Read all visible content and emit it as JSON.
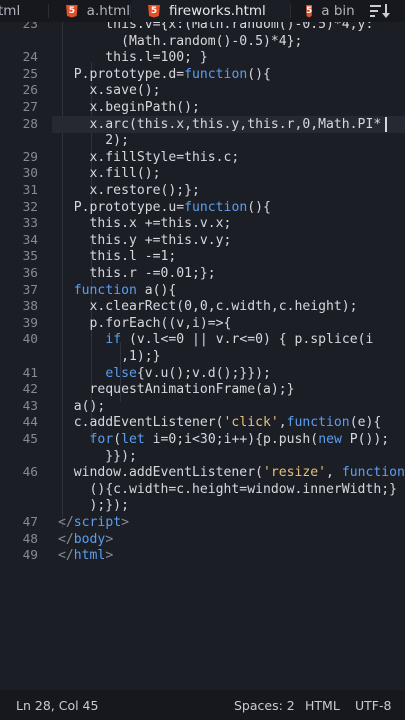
{
  "tabs": [
    {
      "label": "tml",
      "html_icon": false,
      "active": false
    },
    {
      "label": "a.html",
      "html_icon": true,
      "active": false
    },
    {
      "label": "fireworks.html",
      "html_icon": true,
      "active": true
    },
    {
      "label": "a bing",
      "html_icon": true,
      "active": false
    }
  ],
  "icons": {
    "html_file": "html5-file-icon",
    "html_glyph": "5",
    "tab_overflow": "sort-list-icon"
  },
  "editor": {
    "lines": [
      {
        "n": "23",
        "top_clip": true,
        "segs": [
          [
            "      this.v={x:(Math.random()-0.5)*4,y:",
            ""
          ]
        ]
      },
      {
        "n": "",
        "segs": [
          [
            "        (Math.random()-0.5)*4};",
            ""
          ]
        ]
      },
      {
        "n": "24",
        "segs": [
          [
            "      this.l=100; }",
            ""
          ]
        ]
      },
      {
        "n": "25",
        "segs": [
          [
            "  P.prototype.d=",
            ""
          ],
          [
            "function",
            "k"
          ],
          [
            "(){",
            ""
          ]
        ]
      },
      {
        "n": "26",
        "segs": [
          [
            "    x.save();",
            ""
          ]
        ]
      },
      {
        "n": "27",
        "segs": [
          [
            "    x.beginPath();",
            ""
          ]
        ]
      },
      {
        "n": "28",
        "current": true,
        "segs": [
          [
            "    x.arc(this.x,this.y,this.r,0,Math.PI*",
            ""
          ]
        ]
      },
      {
        "n": "",
        "segs": [
          [
            "      2);",
            ""
          ]
        ]
      },
      {
        "n": "29",
        "segs": [
          [
            "    x.fillStyle=this.c;",
            ""
          ]
        ]
      },
      {
        "n": "30",
        "segs": [
          [
            "    x.fill();",
            ""
          ]
        ]
      },
      {
        "n": "31",
        "segs": [
          [
            "    x.restore();};",
            ""
          ]
        ]
      },
      {
        "n": "32",
        "segs": [
          [
            "  P.prototype.u=",
            ""
          ],
          [
            "function",
            "k"
          ],
          [
            "(){",
            ""
          ]
        ]
      },
      {
        "n": "33",
        "segs": [
          [
            "    this.x +=this.v.x;",
            ""
          ]
        ]
      },
      {
        "n": "34",
        "segs": [
          [
            "    this.y +=this.v.y;",
            ""
          ]
        ]
      },
      {
        "n": "35",
        "segs": [
          [
            "    this.l -=1;",
            ""
          ]
        ]
      },
      {
        "n": "36",
        "segs": [
          [
            "    this.r -=0.01;};",
            ""
          ]
        ]
      },
      {
        "n": "37",
        "segs": [
          [
            "  ",
            ""
          ],
          [
            "function",
            "k"
          ],
          [
            " a(){",
            ""
          ]
        ]
      },
      {
        "n": "38",
        "segs": [
          [
            "    x.clearRect(0,0,c.width,c.height);",
            ""
          ]
        ]
      },
      {
        "n": "39",
        "segs": [
          [
            "    p.forEach((v,i)=>{",
            ""
          ]
        ]
      },
      {
        "n": "40",
        "segs": [
          [
            "      ",
            ""
          ],
          [
            "if",
            "k"
          ],
          [
            " (v.l<=0 || v.r<=0) { p.splice(i",
            ""
          ]
        ]
      },
      {
        "n": "",
        "segs": [
          [
            "        ,1);}",
            ""
          ]
        ]
      },
      {
        "n": "41",
        "segs": [
          [
            "      ",
            ""
          ],
          [
            "else",
            "k"
          ],
          [
            "{v.u();v.d();}});",
            ""
          ]
        ]
      },
      {
        "n": "42",
        "segs": [
          [
            "    requestAnimationFrame(a);}",
            ""
          ]
        ]
      },
      {
        "n": "43",
        "segs": [
          [
            "  a();",
            ""
          ]
        ]
      },
      {
        "n": "44",
        "segs": [
          [
            "  c.addEventListener(",
            ""
          ],
          [
            "'click'",
            "s"
          ],
          [
            ",",
            ""
          ],
          [
            "function",
            "k"
          ],
          [
            "(e){",
            ""
          ]
        ]
      },
      {
        "n": "45",
        "segs": [
          [
            "    ",
            ""
          ],
          [
            "for",
            "k"
          ],
          [
            "(",
            ""
          ],
          [
            "let",
            "k"
          ],
          [
            " i=0;i<30;i++){p.push(",
            ""
          ],
          [
            "new",
            "k"
          ],
          [
            " P());",
            ""
          ]
        ]
      },
      {
        "n": "",
        "segs": [
          [
            "      }});",
            ""
          ]
        ]
      },
      {
        "n": "46",
        "segs": [
          [
            "  window.addEventListener(",
            ""
          ],
          [
            "'resize'",
            "s"
          ],
          [
            ", ",
            ""
          ],
          [
            "function",
            "k"
          ]
        ]
      },
      {
        "n": "",
        "segs": [
          [
            "    (){c.width=c.height=window.innerWidth;}",
            ""
          ]
        ]
      },
      {
        "n": "",
        "segs": [
          [
            "    );});",
            ""
          ]
        ]
      },
      {
        "n": "47",
        "segs": [
          [
            "</",
            "fold"
          ],
          [
            "script",
            "k"
          ],
          [
            ">",
            "fold"
          ]
        ]
      },
      {
        "n": "48",
        "segs": [
          [
            "</",
            "fold"
          ],
          [
            "body",
            "k"
          ],
          [
            ">",
            "fold"
          ]
        ]
      },
      {
        "n": "49",
        "segs": [
          [
            "</",
            "fold"
          ],
          [
            "html",
            "k"
          ],
          [
            ">",
            "fold"
          ]
        ]
      }
    ]
  },
  "status": {
    "position": "Ln 28, Col 45",
    "indent": "Spaces: 2",
    "language": "HTML",
    "encoding": "UTF-8"
  },
  "colors": {
    "background": "#1c1e26",
    "keyword": "#5b9ef0",
    "string": "#e6c07b",
    "html_icon": "#e34f26"
  }
}
